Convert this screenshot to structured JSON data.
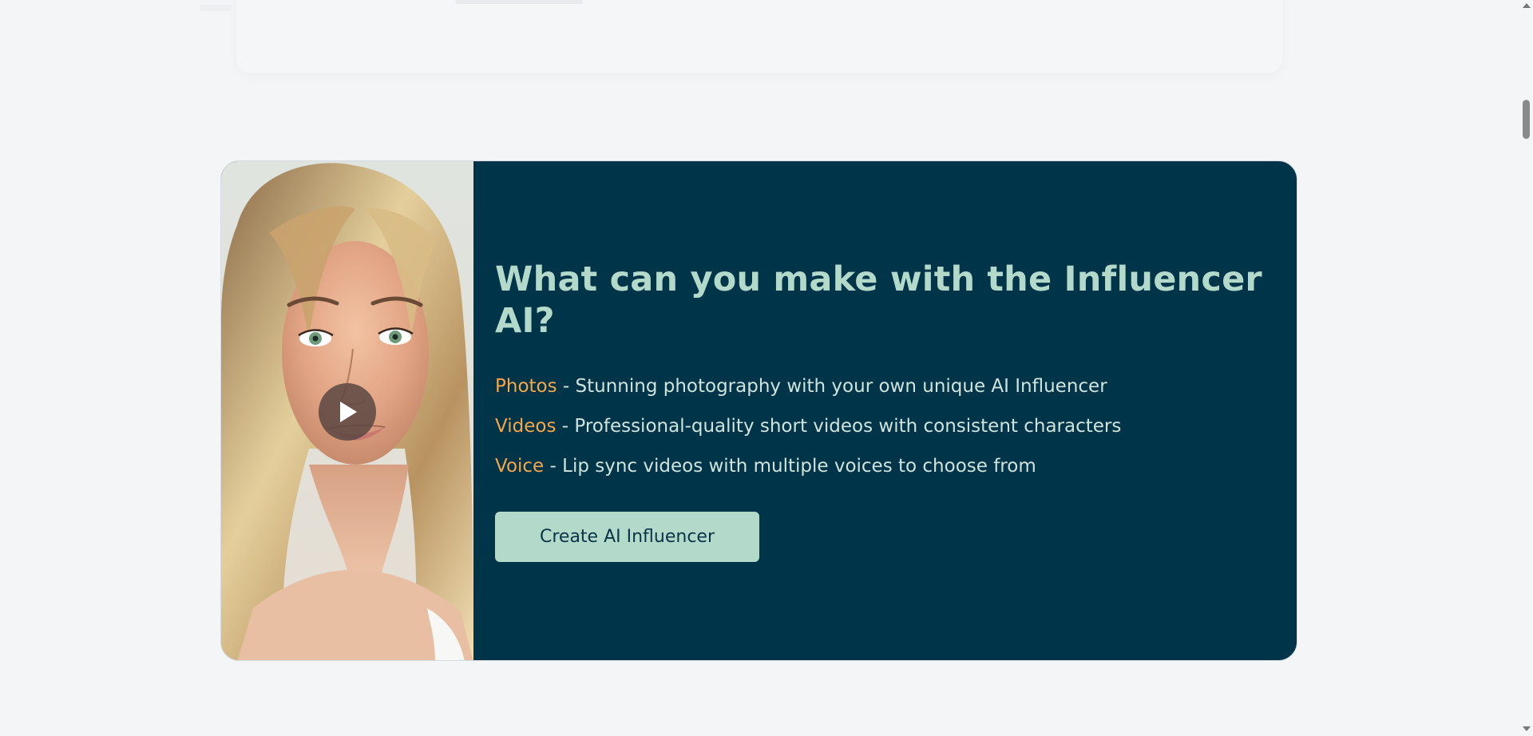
{
  "feature": {
    "headline": "What can you make with the Influencer AI?",
    "items": [
      {
        "keyword": "Photos",
        "description": " - Stunning photography with your own unique AI Influencer"
      },
      {
        "keyword": "Videos",
        "description": " - Professional-quality short videos with consistent characters"
      },
      {
        "keyword": "Voice",
        "description": " - Lip sync videos with multiple voices to choose from"
      }
    ],
    "cta_label": "Create AI Influencer",
    "media_icon": "play-icon"
  },
  "colors": {
    "card_background": "#003549",
    "headline": "#b3d9cb",
    "keyword": "#f5a64a",
    "body_text": "#cfe3dc",
    "button_background": "#b3d9cb",
    "button_text": "#0b3447",
    "page_background": "#f4f5f7"
  }
}
